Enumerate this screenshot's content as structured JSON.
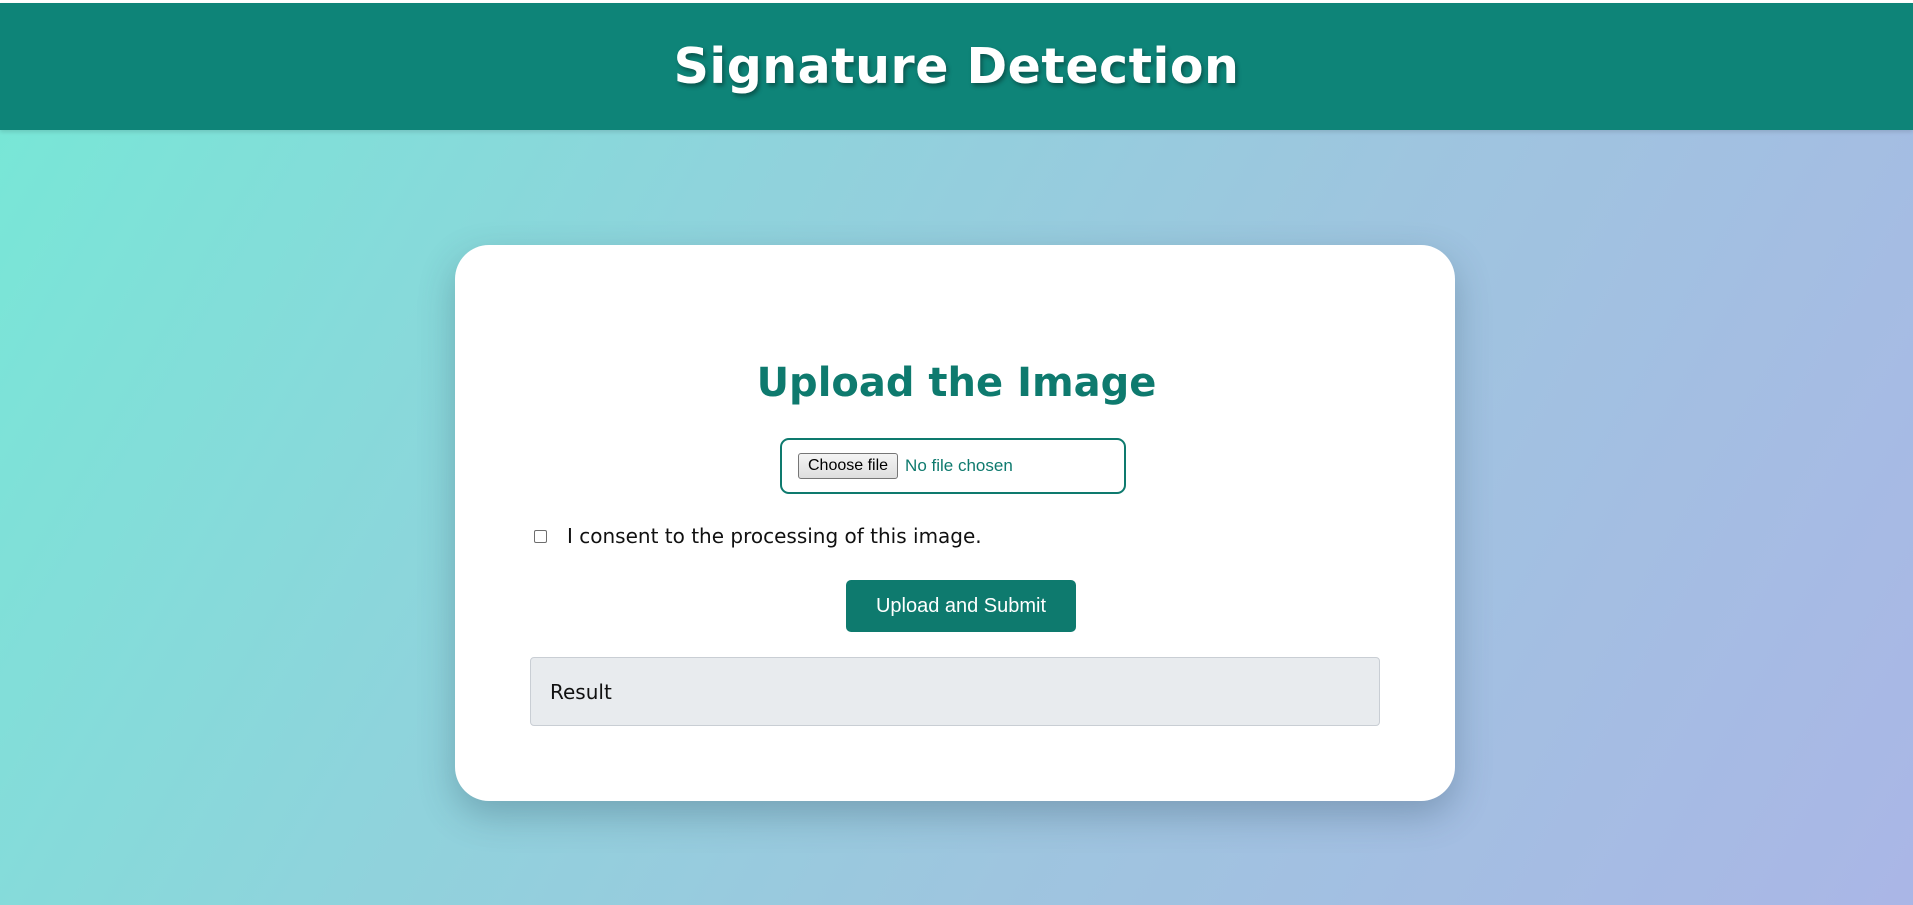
{
  "header": {
    "title": "Signature Detection"
  },
  "upload_card": {
    "title": "Upload the Image",
    "file_input": {
      "button_label": "Choose file",
      "status_text": "No file chosen"
    },
    "consent": {
      "label": "I consent to the processing of this image.",
      "checked": false
    },
    "submit_label": "Upload and Submit",
    "result_label": "Result"
  },
  "colors": {
    "header_bg": "#0e8478",
    "accent": "#0e7a6e",
    "gradient_start": "#76e8d6",
    "gradient_end": "#aab6e6",
    "result_bg": "#e8ebee"
  }
}
